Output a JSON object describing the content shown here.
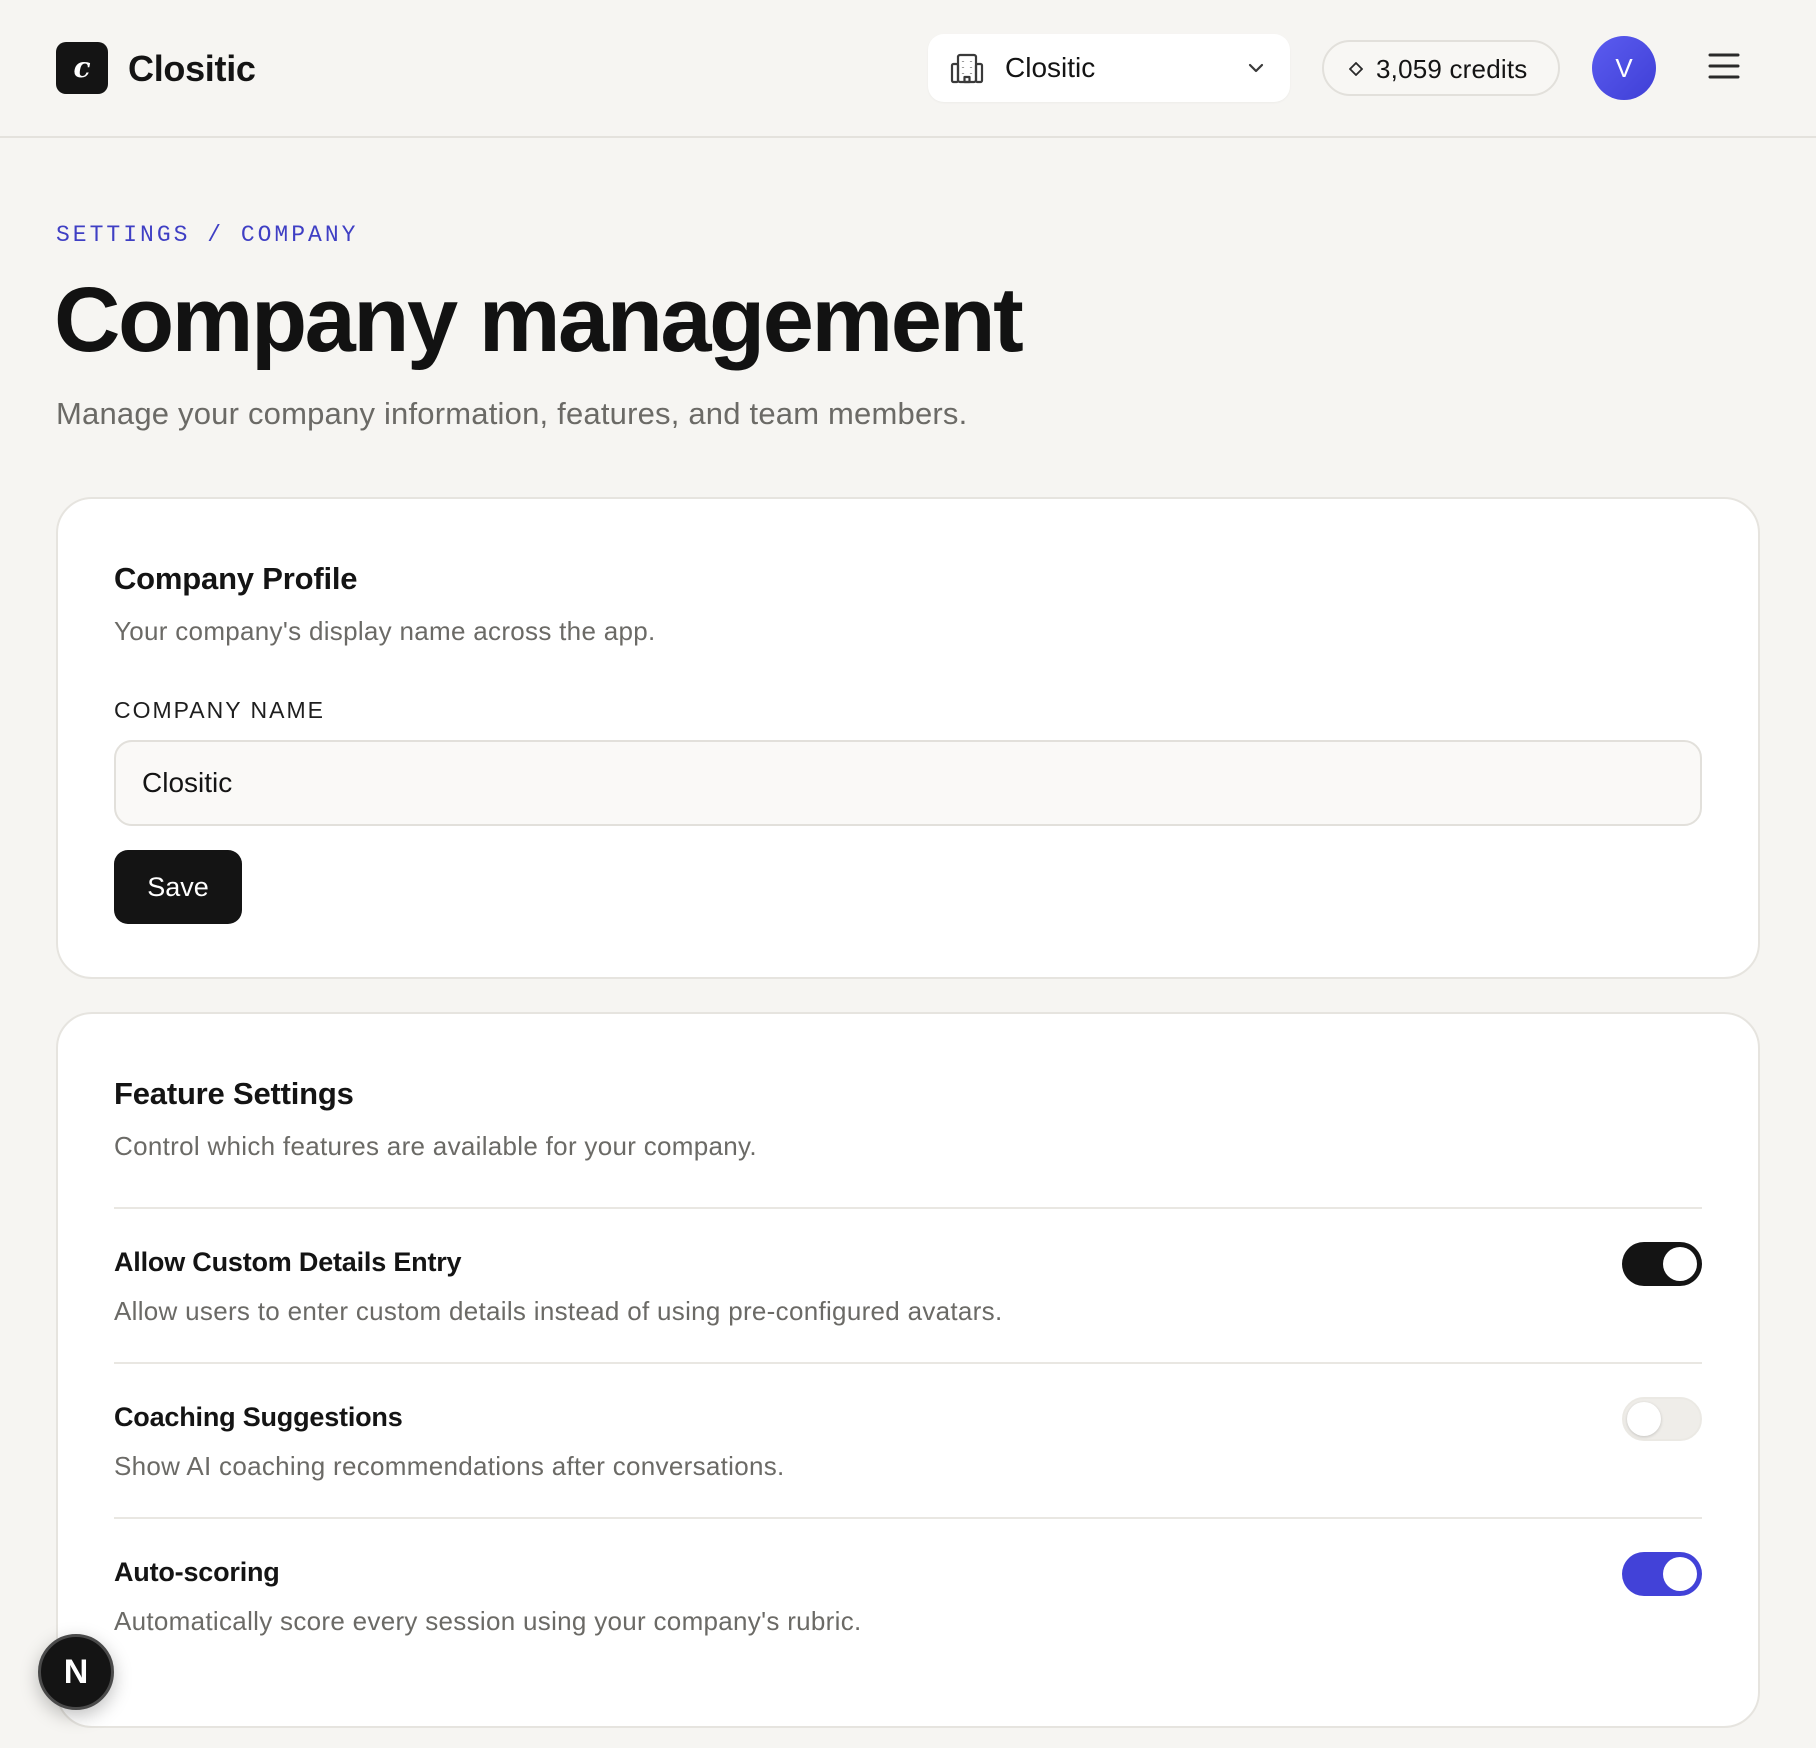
{
  "app": {
    "name": "Clositic",
    "logo_letter": "c"
  },
  "header": {
    "company_selector": {
      "value": "Clositic",
      "icon": "building-icon"
    },
    "credits_label": "3,059 credits",
    "avatar_initial": "V",
    "menu_icon": "hamburger-menu-icon"
  },
  "page": {
    "breadcrumb": "SETTINGS / COMPANY",
    "title": "Company management",
    "subtitle": "Manage your company information, features, and team members."
  },
  "profile_card": {
    "title": "Company Profile",
    "description": "Your company's display name across the app.",
    "field_label": "COMPANY NAME",
    "field_value": "Clositic",
    "save_label": "Save"
  },
  "features_card": {
    "title": "Feature Settings",
    "description": "Control which features are available for your company.",
    "items": [
      {
        "title": "Allow Custom Details Entry",
        "description": "Allow users to enter custom details instead of using pre-configured avatars.",
        "enabled": true
      },
      {
        "title": "Coaching Suggestions",
        "description": "Show AI coaching recommendations after conversations.",
        "enabled": false
      },
      {
        "title": "Auto-scoring",
        "description": "Automatically score every session using your company's rubric.",
        "enabled": true
      }
    ]
  },
  "floating_badge": {
    "letter": "N"
  },
  "colors": {
    "accent": "#4242d8",
    "breadcrumb": "#3f3fc4",
    "primary_button": "#141414",
    "background": "#f6f5f2"
  }
}
